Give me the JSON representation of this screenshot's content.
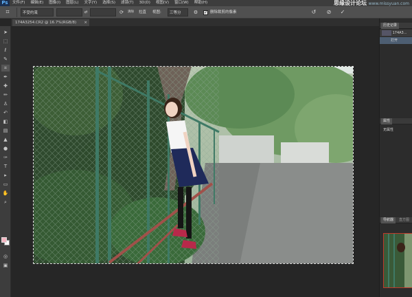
{
  "app": {
    "logo": "Ps",
    "watermark": "思缘设计论坛",
    "watermark_sub": "www.missyuan.com"
  },
  "menu": {
    "items": [
      "文件(F)",
      "编辑(E)",
      "图像(I)",
      "图层(L)",
      "文字(Y)",
      "选择(S)",
      "滤镜(T)",
      "3D(D)",
      "视图(V)",
      "窗口(W)",
      "帮助(H)"
    ]
  },
  "options": {
    "ratio_label": "不受约束",
    "swap_icon": "⇄",
    "clear_label": "清除",
    "straighten_label": "拉直",
    "view_label": "视图:",
    "view_value": "三等分",
    "delete_cropped_label": "删除裁剪的像素",
    "reset_icon": "↺",
    "cancel_icon": "⊘"
  },
  "document": {
    "tab_title": "174A3254.CR2 @ 16.7%(RGB/8)",
    "close_icon": "×"
  },
  "panels": {
    "history": {
      "title": "历史记录",
      "file_row": "174A3...",
      "open_row": "打开"
    },
    "properties": {
      "title": "属性",
      "empty_label": "无属性"
    },
    "navigator": {
      "tab1": "导航器",
      "tab2": "直方图"
    }
  },
  "colors": {
    "foreground": "#f4b4c0",
    "background": "#ffffff"
  }
}
